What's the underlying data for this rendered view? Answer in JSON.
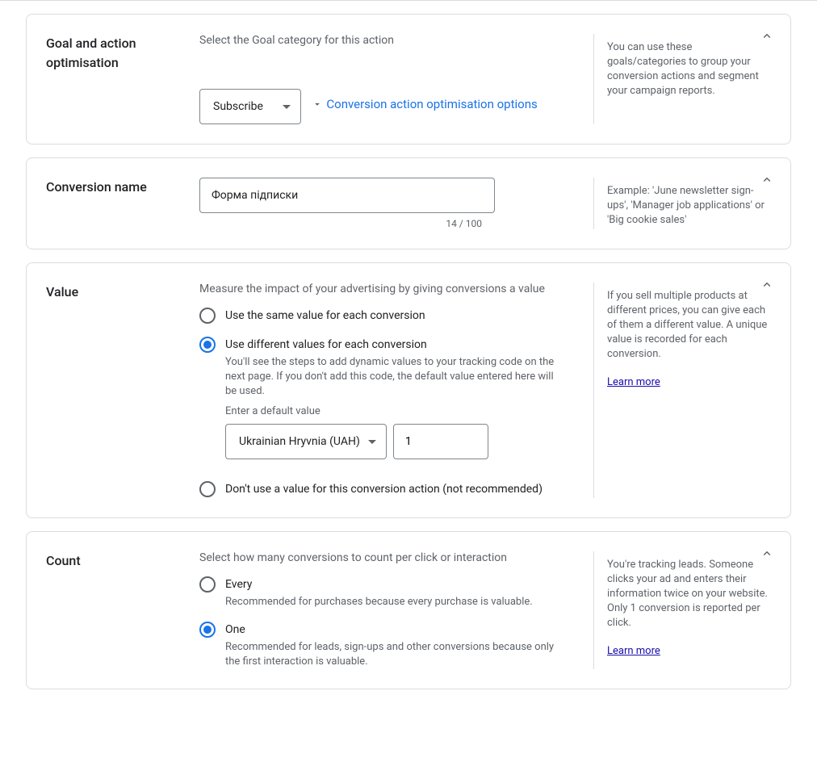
{
  "sections": {
    "goal": {
      "title": "Goal and action optimisation",
      "sub": "Select the Goal category for this action",
      "select_value": "Subscribe",
      "expand_link": "Conversion action optimisation options",
      "help": "You can use these goals/categories to group your conversion actions and segment your campaign reports."
    },
    "name": {
      "title": "Conversion name",
      "value": "Форма підписки",
      "count": "14 / 100",
      "help": "Example: 'June newsletter sign-ups', 'Manager job applications' or 'Big cookie sales'"
    },
    "value": {
      "title": "Value",
      "sub": "Measure the impact of your advertising by giving conversions a value",
      "opt_same": "Use the same value for each conversion",
      "opt_diff": "Use different values for each conversion",
      "diff_hint": "You'll see the steps to add dynamic values to your tracking code on the next page. If you don't add this code, the default value entered here will be used.",
      "default_label": "Enter a default value",
      "currency": "Ukrainian Hryvnia (UAH)",
      "default_value": "1",
      "opt_none": "Don't use a value for this conversion action (not recommended)",
      "help": "If you sell multiple products at different prices, you can give each of them a different value. A unique value is recorded for each conversion.",
      "learn_more": "Learn more"
    },
    "count": {
      "title": "Count",
      "sub": "Select how many conversions to count per click or interaction",
      "opt_every": "Every",
      "every_hint": "Recommended for purchases because every purchase is valuable.",
      "opt_one": "One",
      "one_hint": "Recommended for leads, sign-ups and other conversions because only the first interaction is valuable.",
      "help": "You're tracking leads. Someone clicks your ad and enters their information twice on your website. Only 1 conversion is reported per click.",
      "learn_more": "Learn more"
    }
  }
}
